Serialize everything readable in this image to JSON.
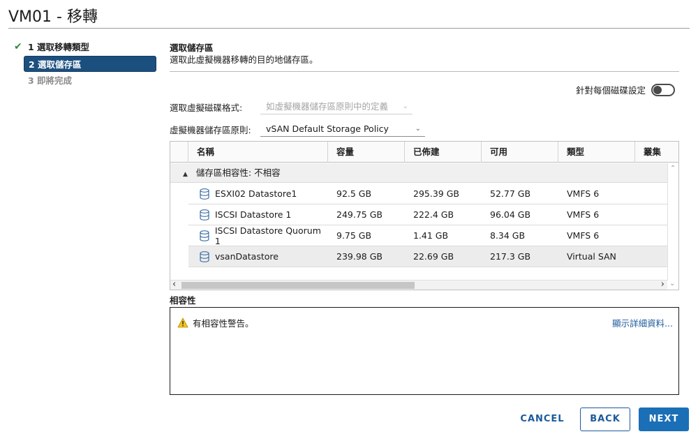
{
  "dialog": {
    "title": "VM01 - 移轉"
  },
  "steps": [
    {
      "label": "1 選取移轉類型",
      "state": "done"
    },
    {
      "label": "2 選取儲存區",
      "state": "active"
    },
    {
      "label": "3 即將完成",
      "state": "disabled"
    }
  ],
  "section": {
    "title": "選取儲存區",
    "subtitle": "選取此虛擬機器移轉的目的地儲存區。"
  },
  "toggle": {
    "label": "針對每個磁碟設定",
    "on": false
  },
  "form": {
    "disk_format_label": "選取虛擬磁碟格式:",
    "disk_format_value": "如虛擬機器儲存區原則中的定義",
    "policy_label": "虛擬機器儲存區原則:",
    "policy_value": "vSAN Default Storage Policy"
  },
  "grid": {
    "columns": [
      "名稱",
      "容量",
      "已佈建",
      "可用",
      "類型",
      "叢集"
    ],
    "group_label": "儲存區相容性: 不相容",
    "rows": [
      {
        "name": "ESXI02 Datastore1",
        "capacity": "92.5 GB",
        "provisioned": "295.39 GB",
        "free": "52.77 GB",
        "type": "VMFS 6"
      },
      {
        "name": "ISCSI Datastore 1",
        "capacity": "249.75 GB",
        "provisioned": "222.4 GB",
        "free": "96.04 GB",
        "type": "VMFS 6"
      },
      {
        "name": "ISCSI Datastore Quorum 1",
        "capacity": "9.75 GB",
        "provisioned": "1.41 GB",
        "free": "8.34 GB",
        "type": "VMFS 6"
      },
      {
        "name": "vsanDatastore",
        "capacity": "239.98 GB",
        "provisioned": "22.69 GB",
        "free": "217.3 GB",
        "type": "Virtual SAN"
      }
    ]
  },
  "compatibility": {
    "label": "相容性",
    "message": "有相容性警告。",
    "details_link": "顯示詳細資料..."
  },
  "buttons": {
    "cancel": "CANCEL",
    "back": "BACK",
    "next": "NEXT"
  },
  "colors": {
    "accent": "#1b6fb6",
    "active_step": "#1b4f7e",
    "check": "#2e8b3a",
    "warning": "#f5c518"
  }
}
